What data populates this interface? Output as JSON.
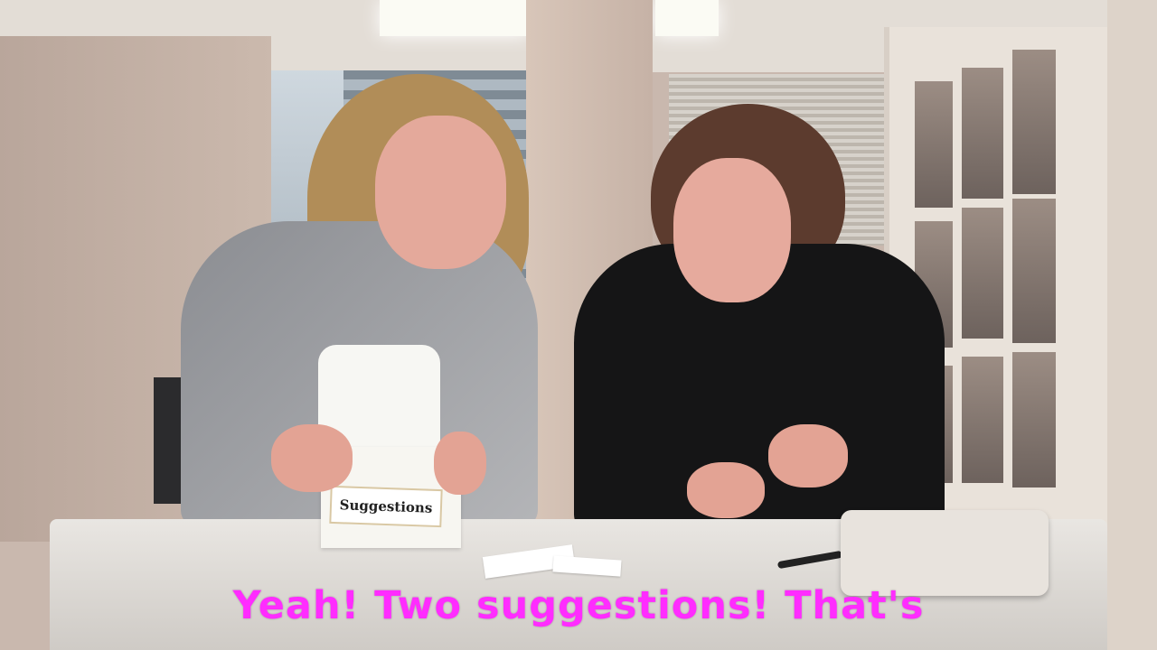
{
  "caption": {
    "text": "Yeah! Two suggestions! That's",
    "color": "#ff2cff"
  },
  "box": {
    "label": "Suggestions"
  },
  "scene": {
    "subjects": [
      "woman-left",
      "woman-right"
    ]
  }
}
